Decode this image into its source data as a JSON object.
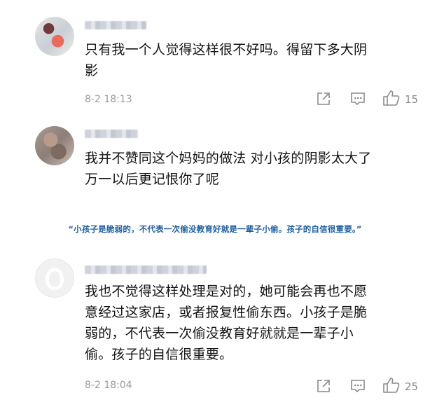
{
  "comments": [
    {
      "text_line1": "只有我一个人觉得这样很不好吗。得留下多大阴",
      "text_line2": "影",
      "time": "8-2 18:13",
      "likes": "15",
      "avatar": "user-photo-avatar"
    },
    {
      "text_line1": "我并不赞同这个妈妈的做法 对小孩的阴影太大了",
      "text_line2": "万一以后更记恨你了呢",
      "avatar": "user-photo-avatar"
    },
    {
      "text_line1": "我也不觉得这样处理是对的，她可能会再也不愿",
      "text_line2": "意经过这家店，或者报复性偷东西。小孩子是脆",
      "text_line3": "弱的，不代表一次偷没教育好就就是一辈子小",
      "text_line4": "偷。孩子的自信很重要。",
      "time": "8-2 18:04",
      "likes": "25",
      "avatar": "default-avatar"
    }
  ],
  "quote": "“小孩子是脆弱的，不代表一次偷没教育好就是一辈子小偷。孩子的自信很重要。”",
  "icons": {
    "share": "share-icon",
    "reply": "comment-icon",
    "like": "thumbs-up-icon"
  },
  "colors": {
    "quote": "#1f5fa0",
    "meta": "#9a9a9a",
    "text": "#141414"
  }
}
